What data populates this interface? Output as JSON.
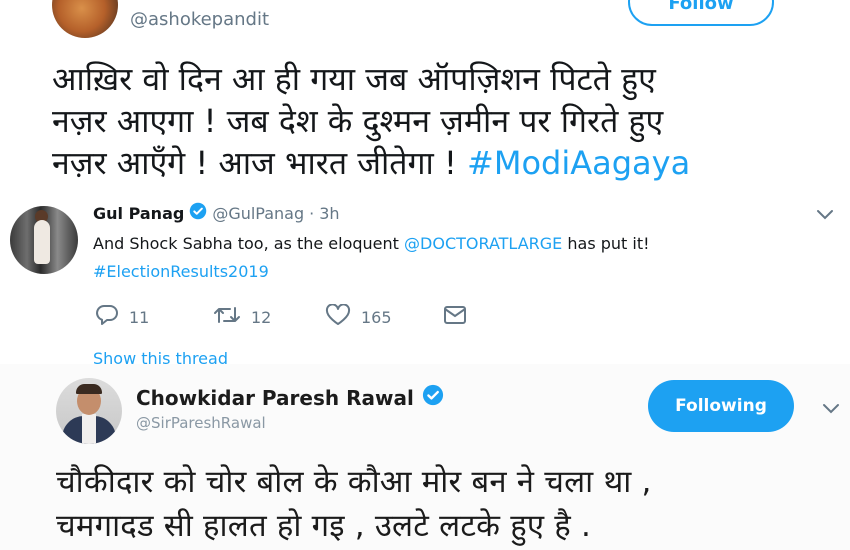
{
  "tweet1": {
    "handle": "@ashokepandit",
    "follow_label": "Follow",
    "text_line1": "आख़िर वो दिन आ ही गया जब ऑपज़िशन पिटते हुए",
    "text_line2": "नज़र आएगा ! जब देश के दुश्मन ज़मीन पर गिरते हुए",
    "text_line3": "नज़र आएँगे ! आज भारत जीतेगा ! ",
    "hashtag": "#ModiAagaya"
  },
  "tweet2": {
    "name": "Gul Panag",
    "handle": "@GulPanag",
    "separator": "·",
    "time": "3h",
    "text_before_mention": "And Shock Sabha too, as the eloquent ",
    "mention": "@DOCTORATLARGE",
    "text_after_mention": " has put it!",
    "hashtag": "#ElectionResults2019",
    "replies": "11",
    "retweets": "12",
    "likes": "165",
    "show_thread": "Show this thread"
  },
  "tweet3": {
    "name": "Chowkidar Paresh Rawal",
    "handle": "@SirPareshRawal",
    "following_label": "Following",
    "text_line1": "चौकीदार को चोर बोल के कौआ मोर बन ने चला था ,",
    "text_line2": "चमगादड सी हालत हो गइ , उलटे लटके हुए है ."
  },
  "icons": {
    "verified": "verified-badge-icon",
    "more": "chevron-down-icon",
    "reply": "reply-icon",
    "retweet": "retweet-icon",
    "like": "heart-icon",
    "dm": "envelope-icon"
  },
  "colors": {
    "twitter_blue": "#1da1f2",
    "secondary_text": "#657786",
    "primary_text": "#14171a"
  }
}
